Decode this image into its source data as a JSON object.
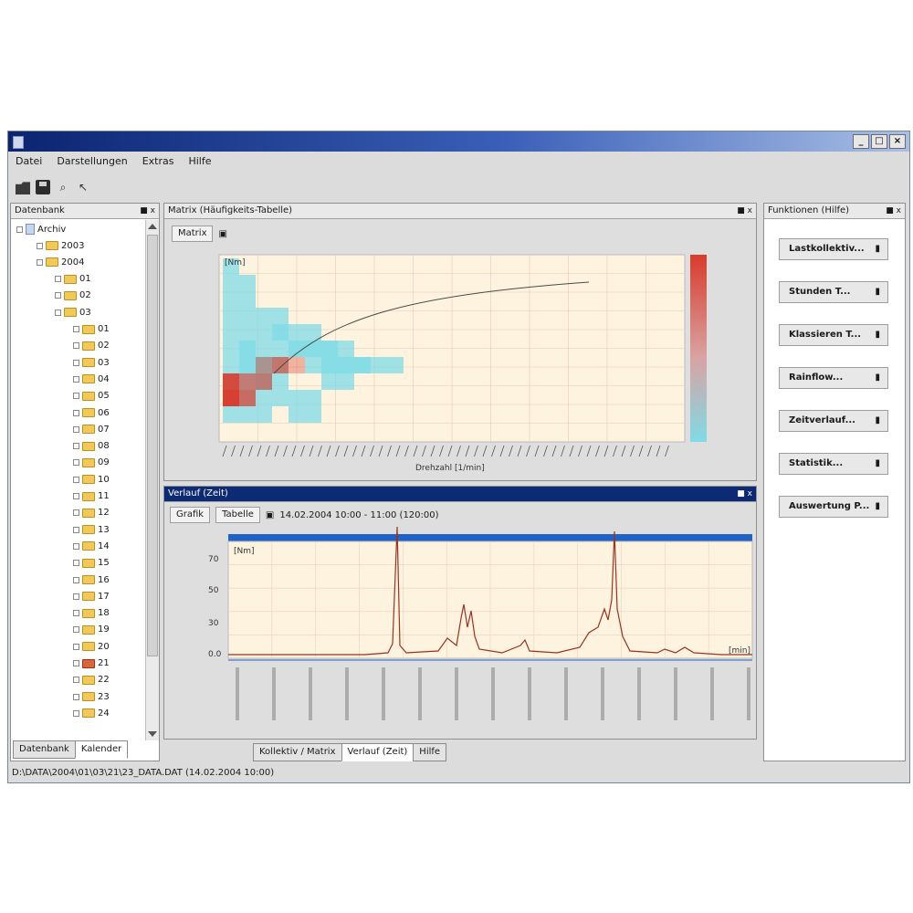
{
  "window": {
    "title": "",
    "controls": [
      "_",
      "□",
      "×"
    ]
  },
  "menu": [
    "Datei",
    "Darstellungen",
    "Extras",
    "Hilfe"
  ],
  "left_panel": {
    "title": "Datenbank",
    "root_label": "Archiv",
    "tree": [
      {
        "label": "2003",
        "level": 1
      },
      {
        "label": "2004",
        "level": 1
      },
      {
        "label": "01",
        "level": 2
      },
      {
        "label": "02",
        "level": 2
      },
      {
        "label": "03",
        "level": 2
      },
      {
        "label": "01",
        "level": 3
      },
      {
        "label": "02",
        "level": 3
      },
      {
        "label": "03",
        "level": 3
      },
      {
        "label": "04",
        "level": 3
      },
      {
        "label": "05",
        "level": 3
      },
      {
        "label": "06",
        "level": 3
      },
      {
        "label": "07",
        "level": 3
      },
      {
        "label": "08",
        "level": 3
      },
      {
        "label": "09",
        "level": 3
      },
      {
        "label": "10",
        "level": 3
      },
      {
        "label": "11",
        "level": 3
      },
      {
        "label": "12",
        "level": 3
      },
      {
        "label": "13",
        "level": 3
      },
      {
        "label": "14",
        "level": 3
      },
      {
        "label": "15",
        "level": 3
      },
      {
        "label": "16",
        "level": 3
      },
      {
        "label": "17",
        "level": 3
      },
      {
        "label": "18",
        "level": 3
      },
      {
        "label": "19",
        "level": 3
      },
      {
        "label": "20",
        "level": 3
      },
      {
        "label": "21",
        "level": 3,
        "selected": true
      },
      {
        "label": "22",
        "level": 3
      },
      {
        "label": "23",
        "level": 3
      },
      {
        "label": "24",
        "level": 3
      }
    ],
    "tabs": [
      "Datenbank",
      "Kalender"
    ]
  },
  "top_chart_panel": {
    "title": "Matrix (Häufigkeits-Tabelle)",
    "tab_label": "Matrix",
    "xlabel": "Drehzahl [1/min]",
    "y_unit": "[Nm]",
    "colors": {
      "low": "#7fdbe6",
      "high": "#d83b2b",
      "bg": "#fdf3df",
      "grid": "#e8c9b6"
    }
  },
  "bottom_chart_panel": {
    "title": "Verlauf (Zeit)",
    "tabs": [
      "Grafik",
      "Tabelle"
    ],
    "info_text": "14.02.2004 10:00 - 11:00 (120:00)",
    "y_unit": "[Nm]",
    "y_ticks": [
      "70",
      "50",
      "30",
      "0.0"
    ],
    "x_unit": "[min]",
    "colors": {
      "bar": "#1f63c7",
      "line": "#9a3320",
      "bg": "#fdf3df",
      "grid": "#efcfc0"
    }
  },
  "right_panel": {
    "title": "Funktionen (Hilfe)",
    "buttons": [
      "Lastkollektiv...",
      "Stunden T...",
      "Klassieren T...",
      "Rainflow...",
      "Zeitverlauf...",
      "Statistik...",
      "Auswertung P..."
    ]
  },
  "bottom_tabs": [
    "Kollektiv / Matrix",
    "Verlauf (Zeit)",
    "Hilfe"
  ],
  "status_bar": "D:\\DATA\\2004\\01\\03\\21\\23_DATA.DAT (14.02.2004 10:00)"
}
